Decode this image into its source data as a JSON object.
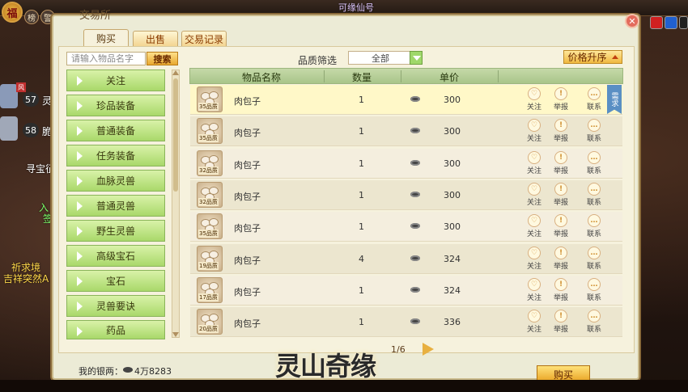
{
  "window": {
    "title": "交易所"
  },
  "hud": {
    "fu": "福",
    "btn1": "榜",
    "btn2": "警",
    "top_center": "可缘仙号",
    "left": [
      {
        "tag": "风",
        "level": "57",
        "text": "灵"
      },
      {
        "level": "58",
        "text": "脆"
      }
    ],
    "left_texts": [
      "寻宝征",
      "入",
      "签",
      "祈求境",
      "吉祥突然A"
    ]
  },
  "tabs": [
    {
      "label": "购买",
      "active": true
    },
    {
      "label": "出售",
      "active": false
    },
    {
      "label": "交易记录",
      "active": false
    }
  ],
  "search": {
    "placeholder": "请输入物品名字",
    "button": "搜索"
  },
  "categories": [
    "关注",
    "珍品装备",
    "普通装备",
    "任务装备",
    "血脉灵兽",
    "普通灵兽",
    "野生灵兽",
    "高级宝石",
    "宝石",
    "灵兽要诀",
    "药品"
  ],
  "filter": {
    "label": "品质筛选",
    "value": "全部"
  },
  "sort": {
    "label": "价格升序"
  },
  "table": {
    "headers": [
      "物品名称",
      "数量",
      "单价"
    ],
    "rows": [
      {
        "quality": "35品质",
        "name": "肉包子",
        "qty": "1",
        "price": "300"
      },
      {
        "quality": "35品质",
        "name": "肉包子",
        "qty": "1",
        "price": "300"
      },
      {
        "quality": "32品质",
        "name": "肉包子",
        "qty": "1",
        "price": "300"
      },
      {
        "quality": "32品质",
        "name": "肉包子",
        "qty": "1",
        "price": "300"
      },
      {
        "quality": "35品质",
        "name": "肉包子",
        "qty": "1",
        "price": "300"
      },
      {
        "quality": "19品质",
        "name": "肉包子",
        "qty": "4",
        "price": "324"
      },
      {
        "quality": "17品质",
        "name": "肉包子",
        "qty": "1",
        "price": "324"
      },
      {
        "quality": "20品质",
        "name": "肉包子",
        "qty": "1",
        "price": "336"
      }
    ],
    "actions": [
      "关注",
      "举报",
      "联系"
    ],
    "bookmark": "需求"
  },
  "footer": {
    "silver_label": "我的银两：",
    "silver_value": "4万8283",
    "page": "1/6",
    "logo": "灵山奇缘",
    "buy": "购买"
  }
}
